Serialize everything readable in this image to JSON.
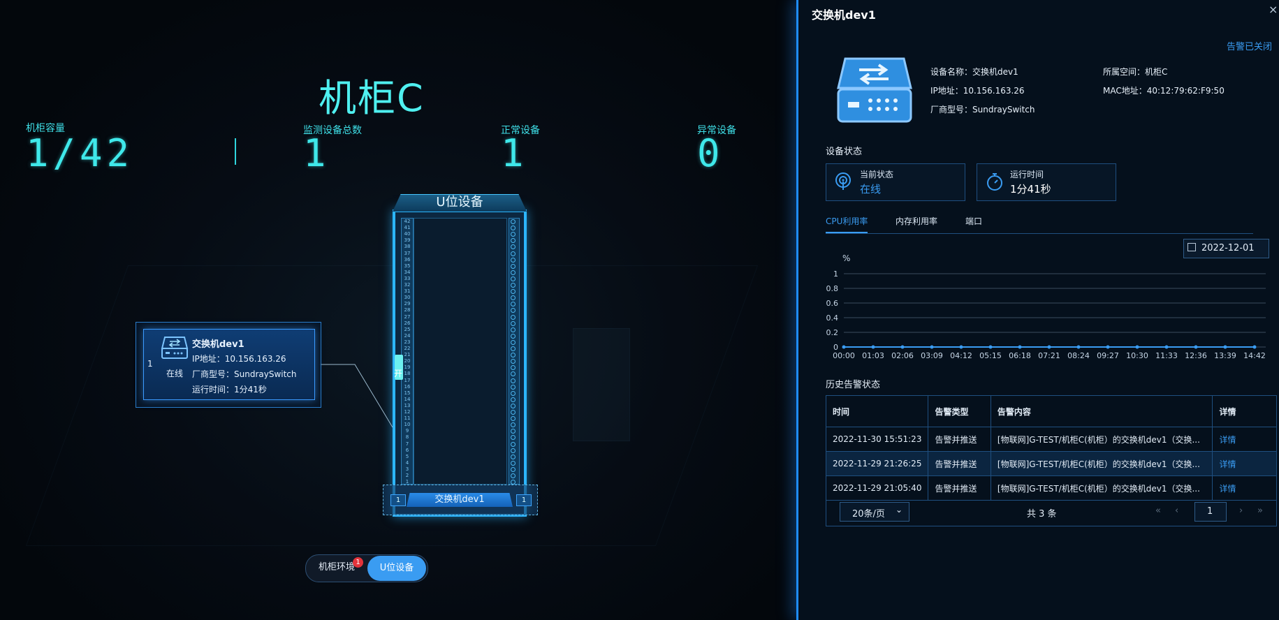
{
  "cabinet": {
    "title": "机柜C",
    "stats": [
      {
        "label": "机柜容量",
        "value": "1/42"
      },
      {
        "label": "监测设备总数",
        "value": "1"
      },
      {
        "label": "正常设备",
        "value": "1"
      },
      {
        "label": "异常设备",
        "value": "0"
      }
    ],
    "rack_title": "U位设备",
    "rack_units": 42,
    "door_label": "开",
    "device_bar": {
      "name": "交换机dev1",
      "u_left": "1",
      "u_right": "1"
    }
  },
  "device_card": {
    "index": "1",
    "status": "在线",
    "name": "交换机dev1",
    "ip": "IP地址：10.156.163.26",
    "vendor": "厂商型号：SundraySwitch",
    "uptime": "运行时间：1分41秒"
  },
  "toggle": {
    "env_label": "机柜环境",
    "badge": "1",
    "u_label": "U位设备"
  },
  "panel": {
    "title": "交换机dev1",
    "close": "×",
    "alarm_closed": "告警已关闭",
    "info": {
      "name": "设备名称：交换机dev1",
      "space": "所属空间：机柜C",
      "ip": "IP地址：10.156.163.26",
      "mac": "MAC地址：40:12:79:62:F9:50",
      "vendor": "厂商型号：SundraySwitch"
    },
    "status_section": "设备状态",
    "current_status_label": "当前状态",
    "current_status_value": "在线",
    "runtime_label": "运行时间",
    "runtime_value": "1分41秒",
    "tabs": [
      "CPU利用率",
      "内存利用率",
      "端口"
    ],
    "date": "2022-12-01",
    "history_section": "历史告警状态",
    "table": {
      "headers": [
        "时间",
        "告警类型",
        "告警内容",
        "详情"
      ],
      "rows": [
        [
          "2022-11-30 15:51:23",
          "告警并推送",
          "[物联网]G-TEST/机柜C(机柜）的交换机dev1（交换...",
          "详情"
        ],
        [
          "2022-11-29 21:26:25",
          "告警并推送",
          "[物联网]G-TEST/机柜C(机柜）的交换机dev1（交换...",
          "详情"
        ],
        [
          "2022-11-29 21:05:40",
          "告警并推送",
          "[物联网]G-TEST/机柜C(机柜）的交换机dev1（交换...",
          "详情"
        ]
      ]
    },
    "pager": {
      "page_size": "20条/页",
      "total": "共 3 条",
      "page": "1"
    }
  },
  "colors": {
    "accent": "#3a9cf2",
    "cyan": "#3fe8ea",
    "rack_border": "#2cb6ff",
    "badge": "#e2333b"
  },
  "chart_data": {
    "type": "line",
    "ylabel": "%",
    "ylim": [
      0,
      1
    ],
    "yticks": [
      "1",
      "0.8",
      "0.6",
      "0.4",
      "0.2",
      "0"
    ],
    "x": [
      "00:00",
      "01:03",
      "02:06",
      "03:09",
      "04:12",
      "05:15",
      "06:18",
      "07:21",
      "08:24",
      "09:27",
      "10:30",
      "11:33",
      "12:36",
      "13:39",
      "14:42"
    ],
    "series": [
      {
        "values": [
          0,
          0,
          0,
          0,
          0,
          0,
          0,
          0,
          0,
          0,
          0,
          0,
          0,
          0,
          0
        ]
      }
    ],
    "grid": true
  }
}
